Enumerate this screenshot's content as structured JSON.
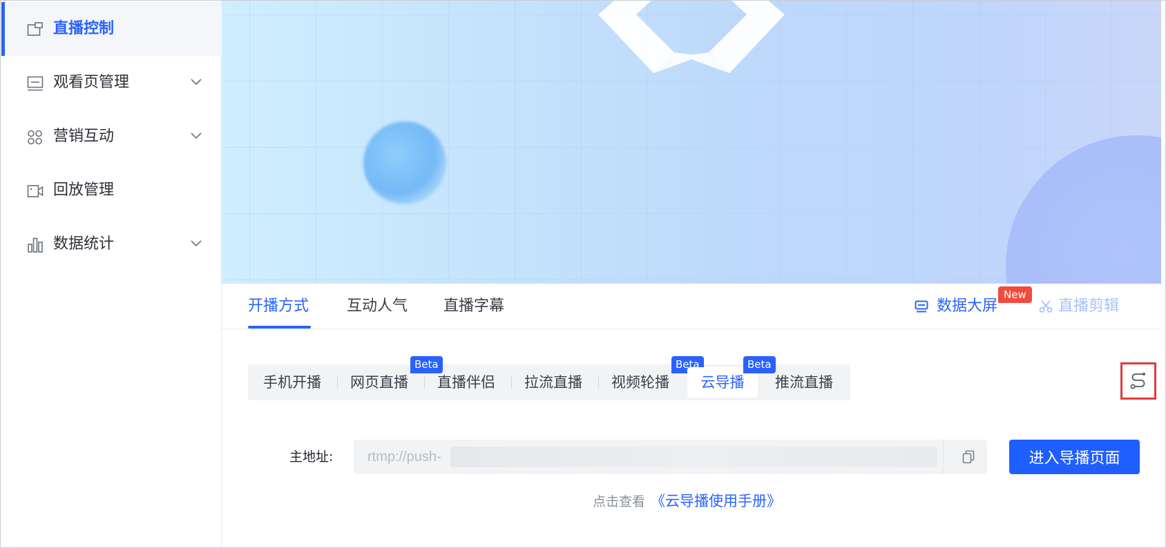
{
  "sidebar": {
    "items": [
      {
        "label": "直播控制",
        "icon": "live-control-icon",
        "active": true,
        "has_submenu": false
      },
      {
        "label": "观看页管理",
        "icon": "monitor-icon",
        "active": false,
        "has_submenu": true
      },
      {
        "label": "营销互动",
        "icon": "grid-apps-icon",
        "active": false,
        "has_submenu": true
      },
      {
        "label": "回放管理",
        "icon": "video-camera-icon",
        "active": false,
        "has_submenu": false
      },
      {
        "label": "数据统计",
        "icon": "bar-chart-icon",
        "active": false,
        "has_submenu": true
      }
    ]
  },
  "tabs": {
    "items": [
      "开播方式",
      "互动人气",
      "直播字幕"
    ],
    "active_index": 0
  },
  "tools": {
    "data_screen": "数据大屏",
    "new_badge": "New",
    "live_clip": "直播剪辑"
  },
  "modes": {
    "items": [
      {
        "label": "手机开播",
        "badge": ""
      },
      {
        "label": "网页直播",
        "badge": "Beta"
      },
      {
        "label": "直播伴侣",
        "badge": ""
      },
      {
        "label": "拉流直播",
        "badge": ""
      },
      {
        "label": "视频轮播",
        "badge": "Beta"
      },
      {
        "label": "云导播",
        "badge": "Beta"
      },
      {
        "label": "推流直播",
        "badge": ""
      }
    ],
    "active_index": 5
  },
  "address": {
    "label": "主地址:",
    "value": "rtmp://push-"
  },
  "enter_button": "进入导播页面",
  "help": {
    "prefix": "点击查看",
    "link": "《云导播使用手册》"
  },
  "colors": {
    "accent": "#2a62ff",
    "badge_new": "#f24b3e",
    "highlight_border": "#e03a3a"
  }
}
